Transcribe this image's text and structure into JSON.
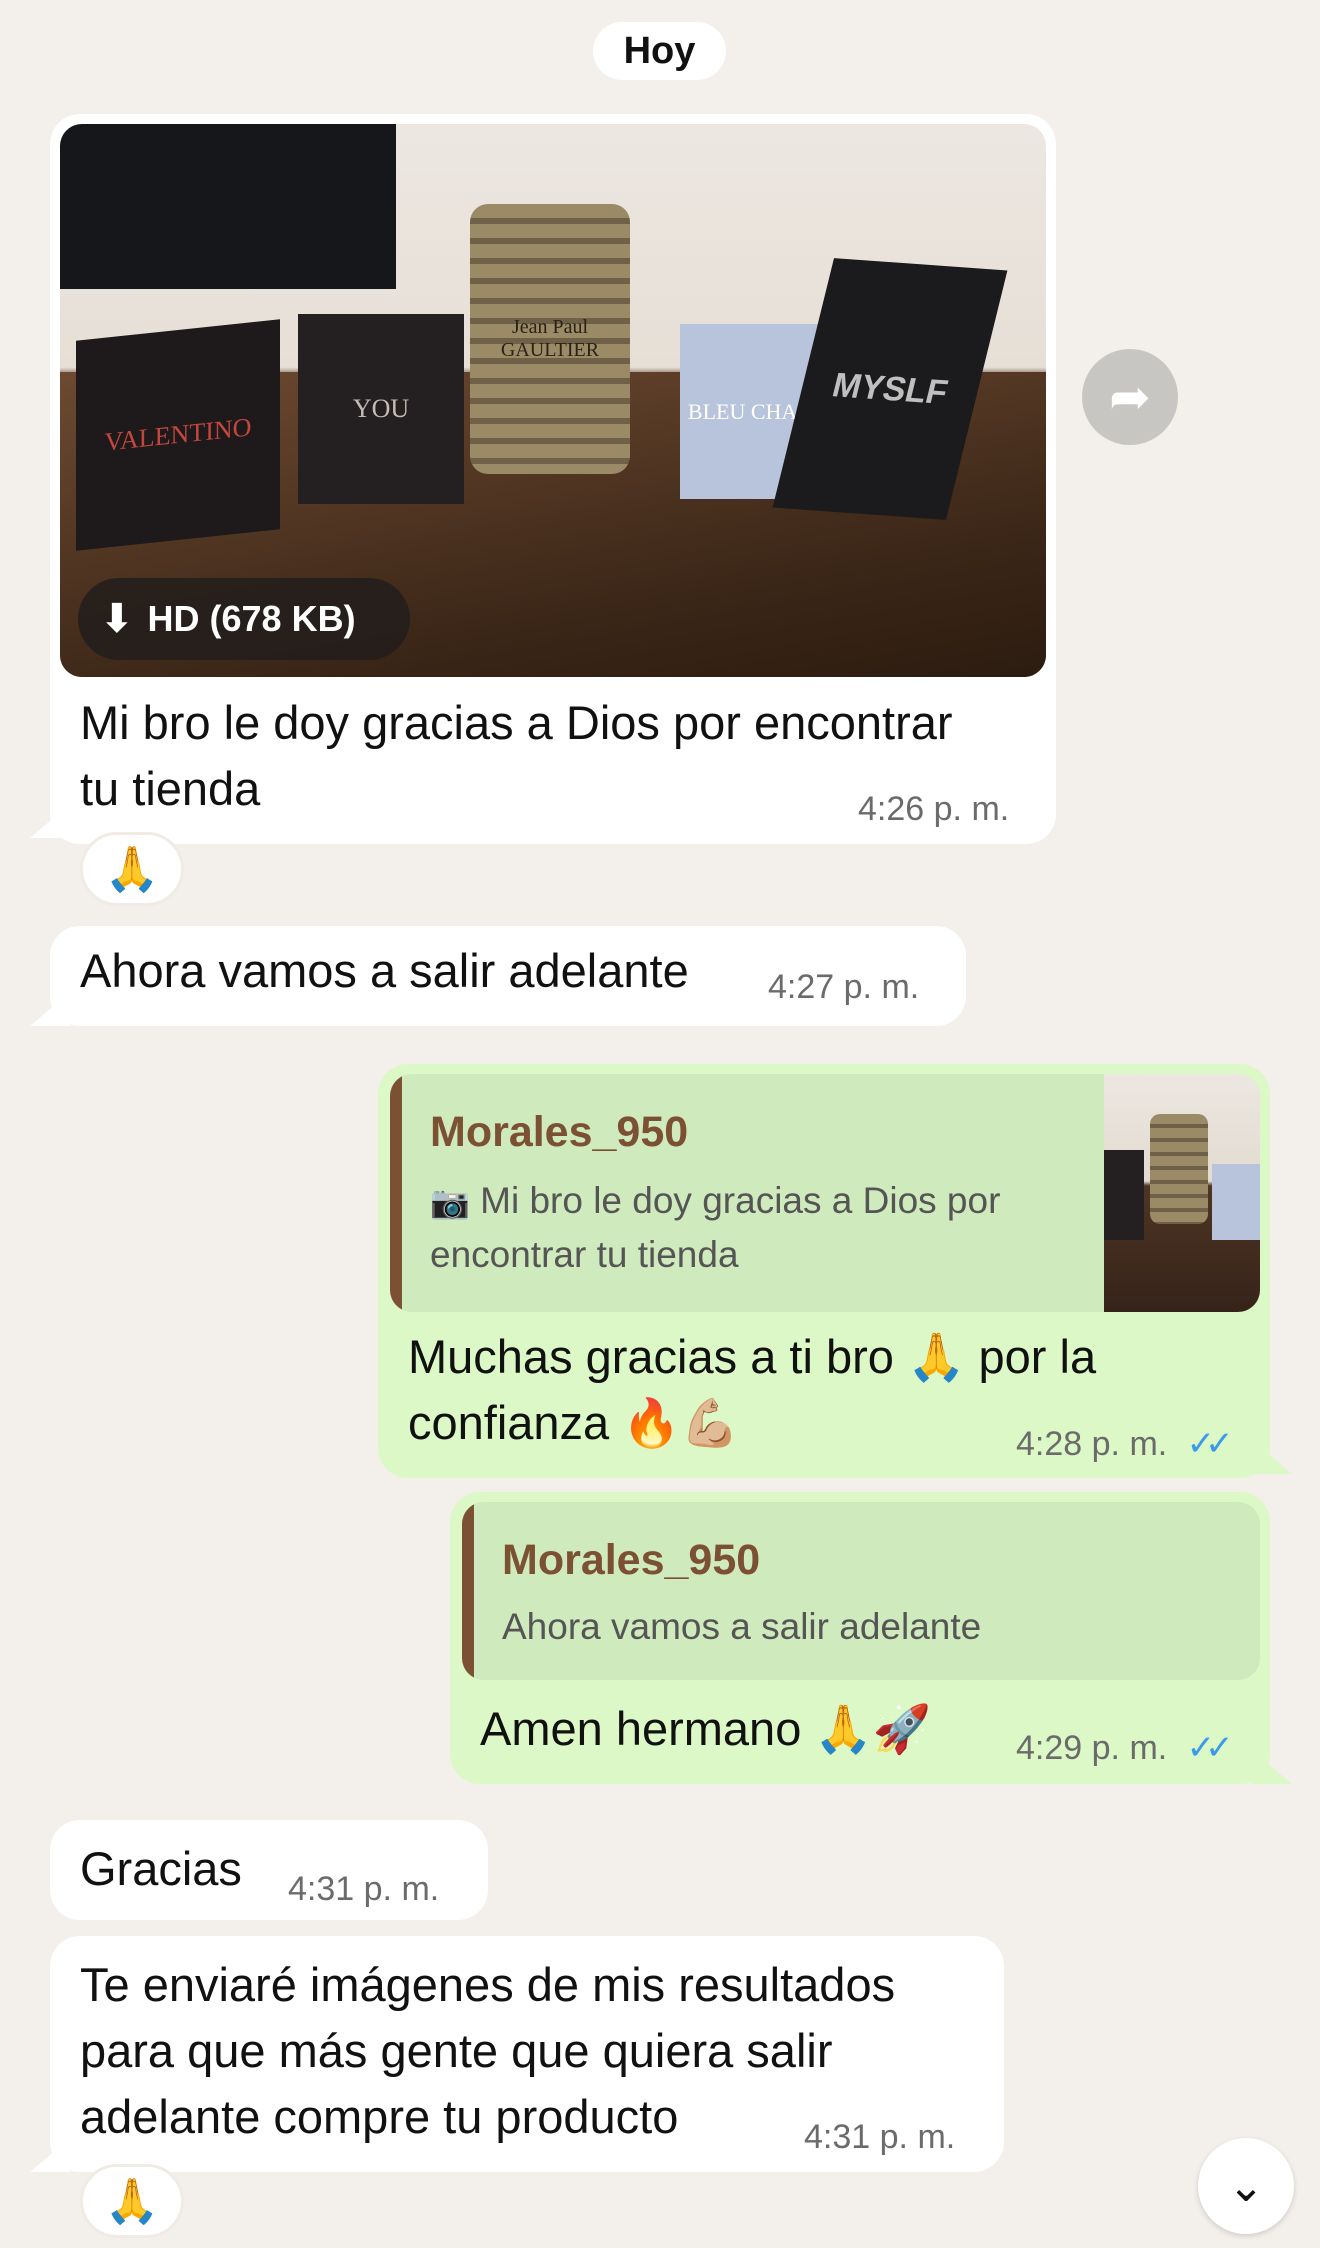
{
  "date_pill": "Hoy",
  "messages": [
    {
      "caption_line1": "Mi bro le doy gracias a Dios por encontrar",
      "caption_line2": "tu tienda",
      "time": "4:26",
      "ampm": "p. m.",
      "hd_label": "HD (678 KB)",
      "reaction": "🙏"
    },
    {
      "text": "Ahora vamos a salir adelante",
      "time": "4:27",
      "ampm": "p. m."
    },
    {
      "quote_name": "Morales_950",
      "quote_line1": "Mi bro le doy gracias a Dios por",
      "quote_line2": "encontrar tu tienda",
      "line1": "Muchas gracias a ti bro 🙏 por la",
      "line2": "confianza 🔥💪🏼",
      "time": "4:28",
      "ampm": "p. m."
    },
    {
      "quote_name": "Morales_950",
      "quote_text": "Ahora vamos a salir adelante",
      "text": "Amen hermano 🙏🚀",
      "time": "4:29",
      "ampm": "p. m."
    },
    {
      "text": "Gracias",
      "time": "4:31",
      "ampm": "p. m."
    },
    {
      "line1": "Te enviaré imágenes de mis resultados",
      "line2": "para que más gente que quiera salir",
      "line3": "adelante compre tu producto",
      "time": "4:31",
      "ampm": "p. m.",
      "reaction": "🙏"
    }
  ],
  "photo_labels": {
    "valentino": "VALENTINO",
    "you": "YOU",
    "jpg": "Jean Paul GAULTIER",
    "bleu": "BLEU CHANEL",
    "myslf": "MYSLF"
  },
  "icons": {
    "share": "share-icon",
    "download": "download-icon",
    "camera": "camera-icon",
    "read_ticks": "double-check-icon",
    "scroll": "chevron-down-icon"
  },
  "colors": {
    "background": "#f3efea",
    "outgoing_bubble": "#dcf8c6",
    "incoming_bubble": "#ffffff",
    "quote_accent": "#7b5033",
    "read_ticks": "#3a9be8"
  }
}
